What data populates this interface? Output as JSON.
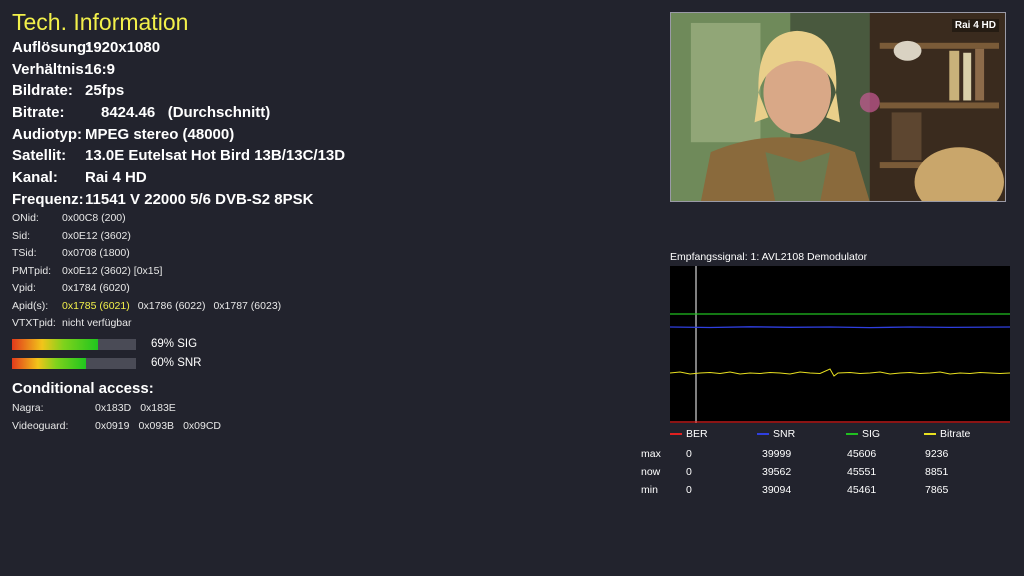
{
  "title": "Tech. Information",
  "info": [
    {
      "label": "Auflösung:",
      "value": "1920x1080"
    },
    {
      "label": "Verhältnis:",
      "value": "16:9"
    },
    {
      "label": "Bildrate:",
      "value": "25fps"
    },
    {
      "label": "Bitrate:",
      "value": "8424.46   (Durchschnitt)"
    },
    {
      "label": "Audiotyp:",
      "value": "MPEG stereo (48000)"
    },
    {
      "label": "Satellit:",
      "value": "13.0E Eutelsat Hot Bird 13B/13C/13D"
    },
    {
      "label": "Kanal:",
      "value": "Rai 4 HD"
    },
    {
      "label": "Frequenz:",
      "value": "11541 V 22000 5/6 DVB-S2 8PSK"
    }
  ],
  "ids": [
    {
      "label": "ONid:",
      "value": "0x00C8 (200)"
    },
    {
      "label": "Sid:",
      "value": "0x0E12 (3602)"
    },
    {
      "label": "TSid:",
      "value": "0x0708 (1800)"
    },
    {
      "label": "PMTpid:",
      "value": "0x0E12 (3602) [0x15]"
    },
    {
      "label": "Vpid:",
      "value": "0x1784 (6020)"
    }
  ],
  "apids": {
    "label": "Apid(s):",
    "values": [
      "0x1785 (6021)",
      "0x1786 (6022)",
      "0x1787 (6023)"
    ],
    "active_index": 0
  },
  "vtxt": {
    "label": "VTXTpid:",
    "value": "nicht verfügbar"
  },
  "signal": {
    "sig_percent": 69,
    "sig_label": "69% SIG",
    "snr_percent": 60,
    "snr_label": "60% SNR"
  },
  "conditional_access": {
    "title": "Conditional access:",
    "systems": [
      {
        "label": "Nagra:",
        "ids": [
          "0x183D",
          "0x183E"
        ]
      },
      {
        "label": "Videoguard:",
        "ids": [
          "0x0919",
          "0x093B",
          "0x09CD"
        ]
      }
    ]
  },
  "video": {
    "channel_logo": "Rai 4 HD"
  },
  "graph": {
    "title": "Empfangssignal: 1: AVL2108 Demodulator",
    "legend": [
      {
        "name": "BER",
        "color": "#e02020"
      },
      {
        "name": "SNR",
        "color": "#2f3fe0"
      },
      {
        "name": "SIG",
        "color": "#20c020"
      },
      {
        "name": "Bitrate",
        "color": "#e8e020"
      }
    ]
  },
  "stats": {
    "rows": [
      {
        "label": "max",
        "values": [
          "0",
          "39999",
          "45606",
          "9236"
        ]
      },
      {
        "label": "now",
        "values": [
          "0",
          "39562",
          "45551",
          "8851"
        ]
      },
      {
        "label": "min",
        "values": [
          "0",
          "39094",
          "45461",
          "7865"
        ]
      }
    ]
  }
}
